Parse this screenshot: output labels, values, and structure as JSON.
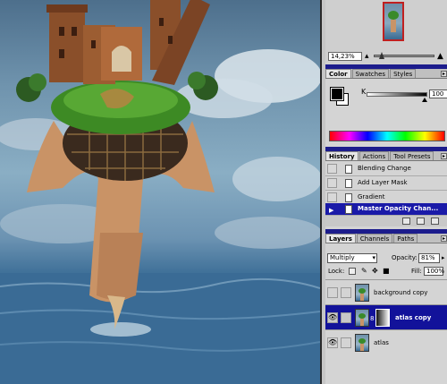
{
  "navigator": {
    "zoom": "14,23%"
  },
  "color": {
    "tabs": [
      "Color",
      "Swatches",
      "Styles"
    ],
    "channel_label": "K",
    "channel_value": "100",
    "foreground": "#000000",
    "background": "#ffffff"
  },
  "history": {
    "tabs": [
      "History",
      "Actions",
      "Tool Presets"
    ],
    "items": [
      {
        "label": "Blending Change"
      },
      {
        "label": "Add Layer Mask"
      },
      {
        "label": "Gradient"
      },
      {
        "label": "Master Opacity Chan..."
      }
    ],
    "selected_index": 3
  },
  "layers": {
    "tabs": [
      "Layers",
      "Channels",
      "Paths"
    ],
    "blend_mode": "Multiply",
    "opacity_label": "Opacity:",
    "opacity_value": "81%",
    "lock_label": "Lock:",
    "fill_label": "Fill:",
    "fill_value": "100%",
    "items": [
      {
        "name": "background copy",
        "visible": false,
        "has_mask": false
      },
      {
        "name": "atlas copy",
        "visible": true,
        "has_mask": true
      },
      {
        "name": "atlas",
        "visible": true,
        "has_mask": false
      }
    ],
    "selected_index": 1
  },
  "colors": {
    "selection": "#12129a",
    "palette_titlebar": "#1c1c8c",
    "palette_bg": "#d4d4d4"
  }
}
